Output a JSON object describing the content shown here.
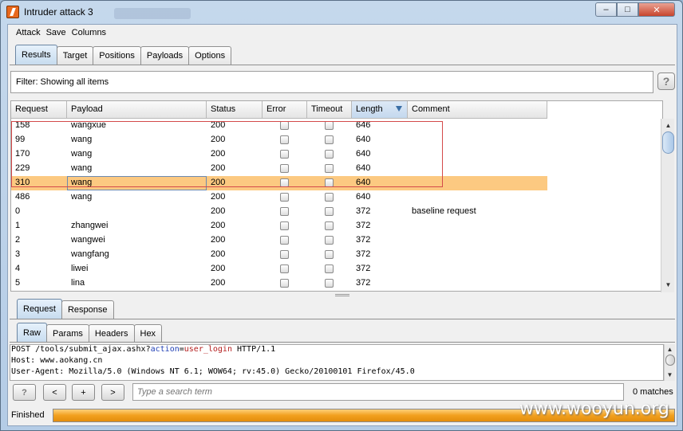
{
  "window": {
    "title": "Intruder attack 3"
  },
  "menu": [
    "Attack",
    "Save",
    "Columns"
  ],
  "main_tabs": [
    "Results",
    "Target",
    "Positions",
    "Payloads",
    "Options"
  ],
  "filter": {
    "text": "Filter: Showing all items",
    "help": "?"
  },
  "table": {
    "columns": [
      "Request",
      "Payload",
      "Status",
      "Error",
      "Timeout",
      "Length",
      "Comment"
    ],
    "sorted_column": "Length",
    "rows": [
      {
        "request": "158",
        "payload": "wangxue",
        "status": "200",
        "error": false,
        "timeout": false,
        "length": "646",
        "comment": ""
      },
      {
        "request": "99",
        "payload": "wang",
        "status": "200",
        "error": false,
        "timeout": false,
        "length": "640",
        "comment": ""
      },
      {
        "request": "170",
        "payload": "wang",
        "status": "200",
        "error": false,
        "timeout": false,
        "length": "640",
        "comment": ""
      },
      {
        "request": "229",
        "payload": "wang",
        "status": "200",
        "error": false,
        "timeout": false,
        "length": "640",
        "comment": ""
      },
      {
        "request": "310",
        "payload": "wang",
        "status": "200",
        "error": false,
        "timeout": false,
        "length": "640",
        "comment": "",
        "selected": true
      },
      {
        "request": "486",
        "payload": "wang",
        "status": "200",
        "error": false,
        "timeout": false,
        "length": "640",
        "comment": ""
      },
      {
        "request": "0",
        "payload": "",
        "status": "200",
        "error": false,
        "timeout": false,
        "length": "372",
        "comment": "baseline request"
      },
      {
        "request": "1",
        "payload": "zhangwei",
        "status": "200",
        "error": false,
        "timeout": false,
        "length": "372",
        "comment": ""
      },
      {
        "request": "2",
        "payload": "wangwei",
        "status": "200",
        "error": false,
        "timeout": false,
        "length": "372",
        "comment": ""
      },
      {
        "request": "3",
        "payload": "wangfang",
        "status": "200",
        "error": false,
        "timeout": false,
        "length": "372",
        "comment": ""
      },
      {
        "request": "4",
        "payload": "liwei",
        "status": "200",
        "error": false,
        "timeout": false,
        "length": "372",
        "comment": ""
      },
      {
        "request": "5",
        "payload": "lina",
        "status": "200",
        "error": false,
        "timeout": false,
        "length": "372",
        "comment": ""
      }
    ]
  },
  "rr_tabs": [
    "Request",
    "Response"
  ],
  "view_tabs": [
    "Raw",
    "Params",
    "Headers",
    "Hex"
  ],
  "request_lines": [
    {
      "pre": "POST /tools/submit_ajax.ashx?",
      "key": "action",
      "eq": "=",
      "val": "user_login",
      "post": " HTTP/1.1"
    },
    {
      "pre": "Host: www.aokang.cn"
    },
    {
      "pre": "User-Agent: Mozilla/5.0 (Windows NT 6.1; WOW64; rv:45.0) Gecko/20100101 Firefox/45.0"
    }
  ],
  "search": {
    "help": "?",
    "prev": "<",
    "add": "+",
    "next": ">",
    "placeholder": "Type a search term",
    "matches": "0 matches"
  },
  "status": {
    "text": "Finished",
    "progress": 1.0
  },
  "watermark": "www.wooyun.org",
  "colors": {
    "selected_row": "#fcc981",
    "highlight_box": "#d44a4a",
    "progress": "#f2a01e"
  }
}
